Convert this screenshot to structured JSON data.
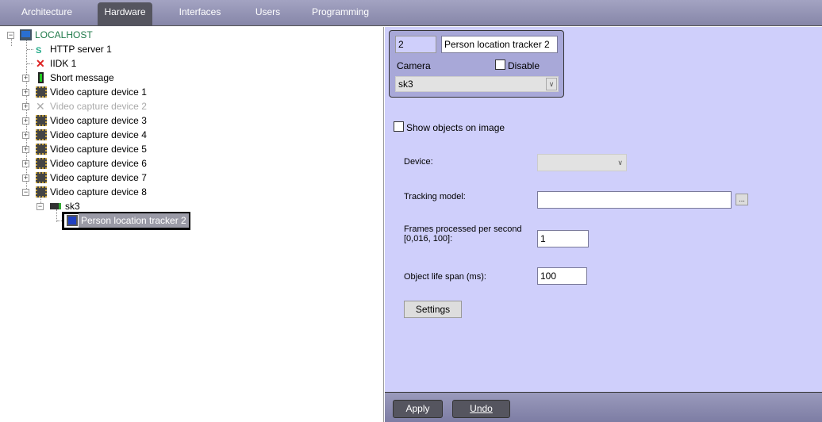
{
  "tabs": [
    "Architecture",
    "Hardware",
    "Interfaces",
    "Users",
    "Programming"
  ],
  "active_tab": "Hardware",
  "tree": {
    "root": "LOCALHOST",
    "items": [
      "HTTP server 1",
      "IIDK 1",
      "Short message",
      "Video capture device 1",
      "Video capture device 2",
      "Video capture device 3",
      "Video capture device 4",
      "Video capture device 5",
      "Video capture device 6",
      "Video capture device 7",
      "Video capture device 8"
    ],
    "camera": "sk3",
    "selected": "Person location tracker 2"
  },
  "panel": {
    "id": "2",
    "name": "Person location tracker 2",
    "camera_label": "Camera",
    "disable_label": "Disable",
    "camera_value": "sk3",
    "show_objects_label": "Show objects on image",
    "device_label": "Device:",
    "device_value": "",
    "tracking_model_label": "Tracking model:",
    "tracking_model_value": "",
    "browse_label": "...",
    "fps_label_1": "Frames processed per second",
    "fps_label_2": "[0,016, 100]:",
    "fps_value": "1",
    "lifespan_label": "Object life span (ms):",
    "lifespan_value": "100",
    "settings_label": "Settings"
  },
  "footer": {
    "apply": "Apply",
    "undo": "Undo"
  }
}
